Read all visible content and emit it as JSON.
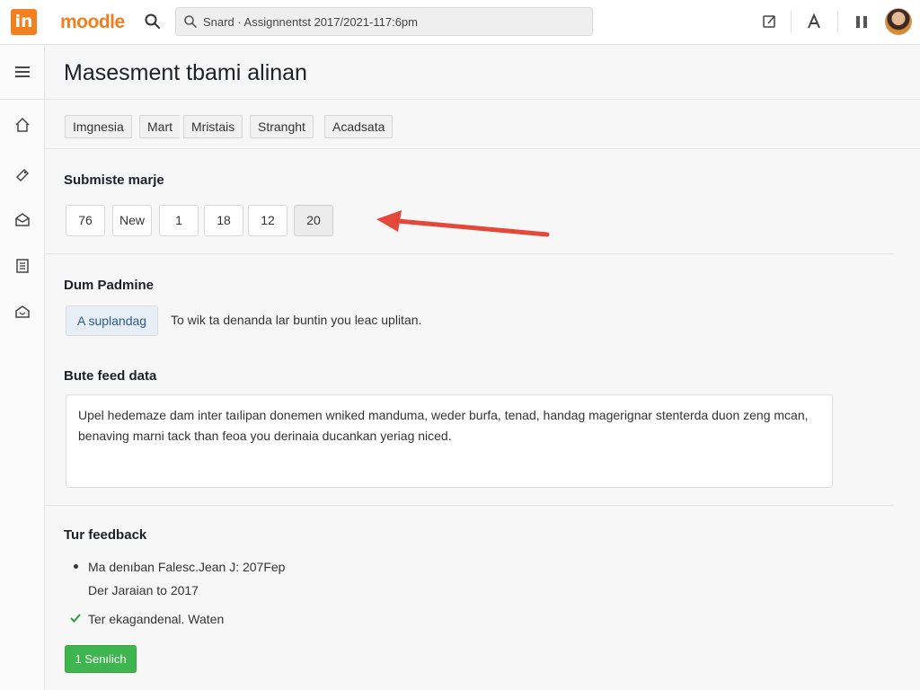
{
  "header": {
    "logo_text": "in",
    "brand_part1": "moo",
    "brand_part2": "dle",
    "search_text": "Snard ·  Assignnentst 2017/2021-117:6pm",
    "icons": [
      "search-icon",
      "edit-icon",
      "font-icon",
      "columns-icon",
      "avatar"
    ]
  },
  "rail": {
    "icons": [
      "menu-icon",
      "home-icon",
      "tag-icon",
      "inbox-icon",
      "document-icon",
      "mailbox-icon"
    ]
  },
  "main": {
    "title": "Masesment tbami alinan",
    "tags": [
      "Imgnesia",
      "Mart",
      "Mristais",
      "Stranght",
      "Acadsata"
    ],
    "submission": {
      "title": "Submiste marje",
      "pages": [
        "76",
        "New",
        "1",
        "18",
        "12",
        "20"
      ],
      "active_page": "20",
      "arrow_color": "#e4483a"
    },
    "upload": {
      "title": "Dum Padmine",
      "button_label": "A suplandag",
      "description": "To wik ta denanda lar buntin you leac uplitan."
    },
    "feedback_data": {
      "title": "Bute feed data",
      "text": "Upel hedemaze dam inter taılipan donemen wniked manduma, weder burfa, tenad, handag magerignar stenterda duon zeng mcan, benaving marni tack than feoa you derinaia ducankan yeriag niced."
    },
    "tur_feedback": {
      "title": "Tur feedback",
      "bullet_line": "Ma denıban Falesc.Jean J: 207Fep",
      "sub_line": "Der Jaraian to 2017",
      "check_line": "Ter ekagandenal. Waten",
      "button_label": "1 Senılich",
      "button_color": "#3fb54f"
    }
  }
}
